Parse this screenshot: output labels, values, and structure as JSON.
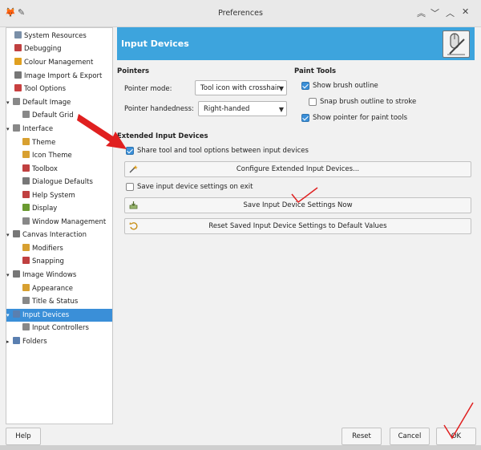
{
  "window": {
    "title": "Preferences"
  },
  "sidebar": {
    "items": [
      {
        "label": "System Resources",
        "icon": "system-resources-icon",
        "color": "#7a8fa8"
      },
      {
        "label": "Debugging",
        "icon": "debugging-icon",
        "color": "#c04040"
      },
      {
        "label": "Colour Management",
        "icon": "colour-management-icon",
        "color": "#e0a020"
      },
      {
        "label": "Image Import & Export",
        "icon": "image-import-export-icon",
        "color": "#777777"
      },
      {
        "label": "Tool Options",
        "icon": "tool-options-icon",
        "color": "#c84040"
      },
      {
        "label": "Default Image",
        "icon": "default-image-icon",
        "color": "#888888"
      },
      {
        "label": "Default Grid",
        "icon": "default-grid-icon",
        "color": "#888888"
      },
      {
        "label": "Interface",
        "icon": "interface-icon",
        "color": "#888888"
      },
      {
        "label": "Theme",
        "icon": "theme-icon",
        "color": "#d8a030"
      },
      {
        "label": "Icon Theme",
        "icon": "icon-theme-icon",
        "color": "#d8a030"
      },
      {
        "label": "Toolbox",
        "icon": "toolbox-icon",
        "color": "#c04040"
      },
      {
        "label": "Dialogue Defaults",
        "icon": "dialogue-defaults-icon",
        "color": "#777777"
      },
      {
        "label": "Help System",
        "icon": "help-system-icon",
        "color": "#c04040"
      },
      {
        "label": "Display",
        "icon": "display-icon",
        "color": "#6a9a30"
      },
      {
        "label": "Window Management",
        "icon": "window-management-icon",
        "color": "#888888"
      },
      {
        "label": "Canvas Interaction",
        "icon": "canvas-interaction-icon",
        "color": "#777777"
      },
      {
        "label": "Modifiers",
        "icon": "modifiers-icon",
        "color": "#d8a030"
      },
      {
        "label": "Snapping",
        "icon": "snapping-icon",
        "color": "#c04040"
      },
      {
        "label": "Image Windows",
        "icon": "image-windows-icon",
        "color": "#777777"
      },
      {
        "label": "Appearance",
        "icon": "appearance-icon",
        "color": "#d8a030"
      },
      {
        "label": "Title & Status",
        "icon": "title-status-icon",
        "color": "#888888"
      },
      {
        "label": "Input Devices",
        "icon": "input-devices-icon",
        "color": "#5a7fb0"
      },
      {
        "label": "Input Controllers",
        "icon": "input-controllers-icon",
        "color": "#888888"
      },
      {
        "label": "Folders",
        "icon": "folders-icon",
        "color": "#5a7fb0"
      }
    ]
  },
  "header": {
    "title": "Input Devices"
  },
  "pointers": {
    "section_title": "Pointers",
    "mode_label": "Pointer mode:",
    "mode_value": "Tool icon with crosshair",
    "handedness_label": "Pointer handedness:",
    "handedness_value": "Right-handed"
  },
  "paint_tools": {
    "section_title": "Paint Tools",
    "show_brush_outline": "Show brush outline",
    "snap_brush_outline": "Snap brush outline to stroke",
    "show_pointer": "Show pointer for paint tools"
  },
  "extended": {
    "section_title": "Extended Input Devices",
    "share_label": "Share tool and tool options between input devices",
    "configure_button": "Configure Extended Input Devices...",
    "save_on_exit_label": "Save input device settings on exit",
    "save_now_button": "Save Input Device Settings Now",
    "reset_button": "Reset Saved Input Device Settings to Default Values"
  },
  "footer": {
    "help": "Help",
    "reset": "Reset",
    "cancel": "Cancel",
    "ok": "OK"
  },
  "colors": {
    "accent": "#3da4dd",
    "selection": "#3a8fd8",
    "annotation": "#e02020"
  }
}
